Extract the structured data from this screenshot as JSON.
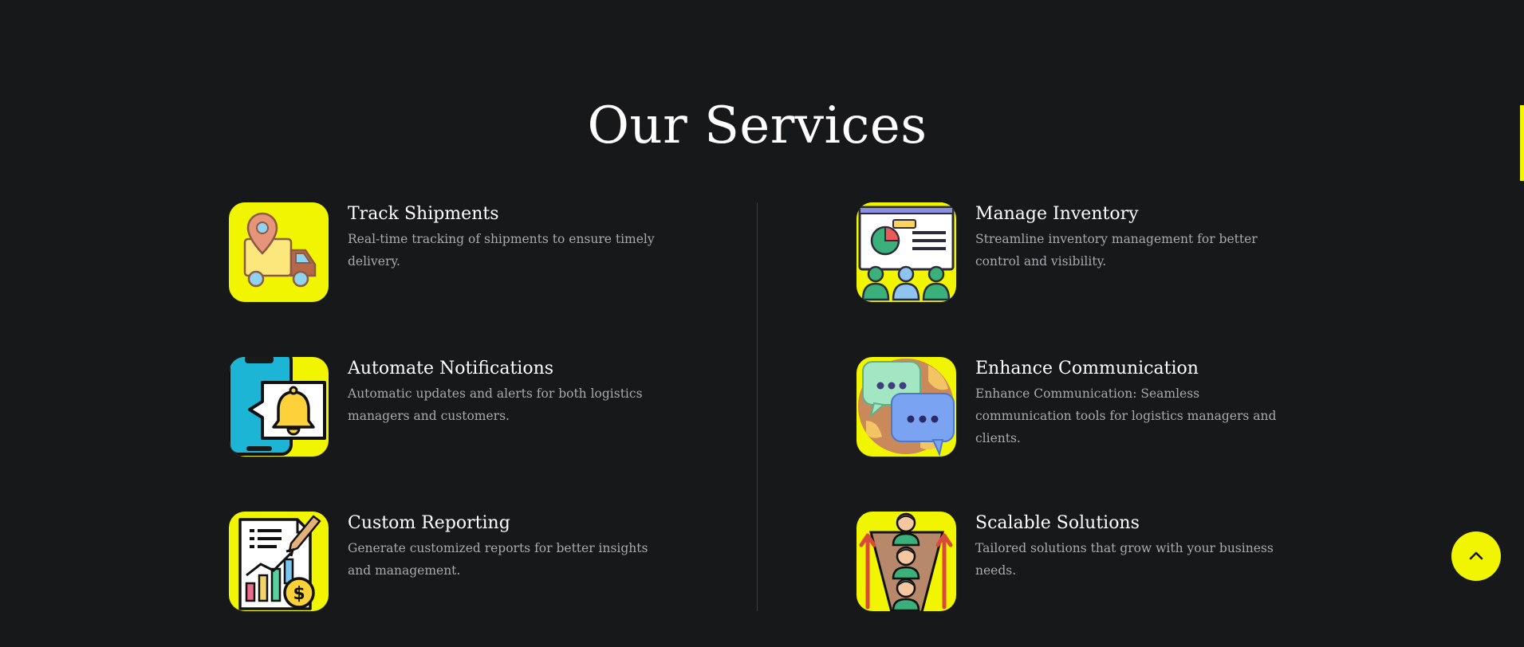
{
  "section": {
    "title": "Our Services"
  },
  "services": [
    {
      "icon": "delivery-truck-location-icon",
      "title": "Track Shipments",
      "description": "Real-time tracking of shipments to ensure timely delivery."
    },
    {
      "icon": "presentation-team-icon",
      "title": "Manage Inventory",
      "description": "Streamline inventory management for better control and visibility."
    },
    {
      "icon": "phone-bell-notification-icon",
      "title": "Automate Notifications",
      "description": "Automatic updates and alerts for both logistics managers and customers."
    },
    {
      "icon": "chat-bubbles-globe-icon",
      "title": "Enhance Communication",
      "description": "Enhance Communication: Seamless communication tools for logistics managers and clients."
    },
    {
      "icon": "report-chart-dollar-icon",
      "title": "Custom Reporting",
      "description": "Generate customized reports for better insights and management."
    },
    {
      "icon": "people-growth-funnel-icon",
      "title": "Scalable Solutions",
      "description": "Tailored solutions that grow with your business needs."
    }
  ],
  "back_to_top": {
    "icon": "chevron-up-icon"
  },
  "colors": {
    "background": "#17181a",
    "accent": "#f2f500",
    "heading": "#ffffff",
    "body_text": "#a9aaad",
    "divider": "#3a3b3e"
  }
}
